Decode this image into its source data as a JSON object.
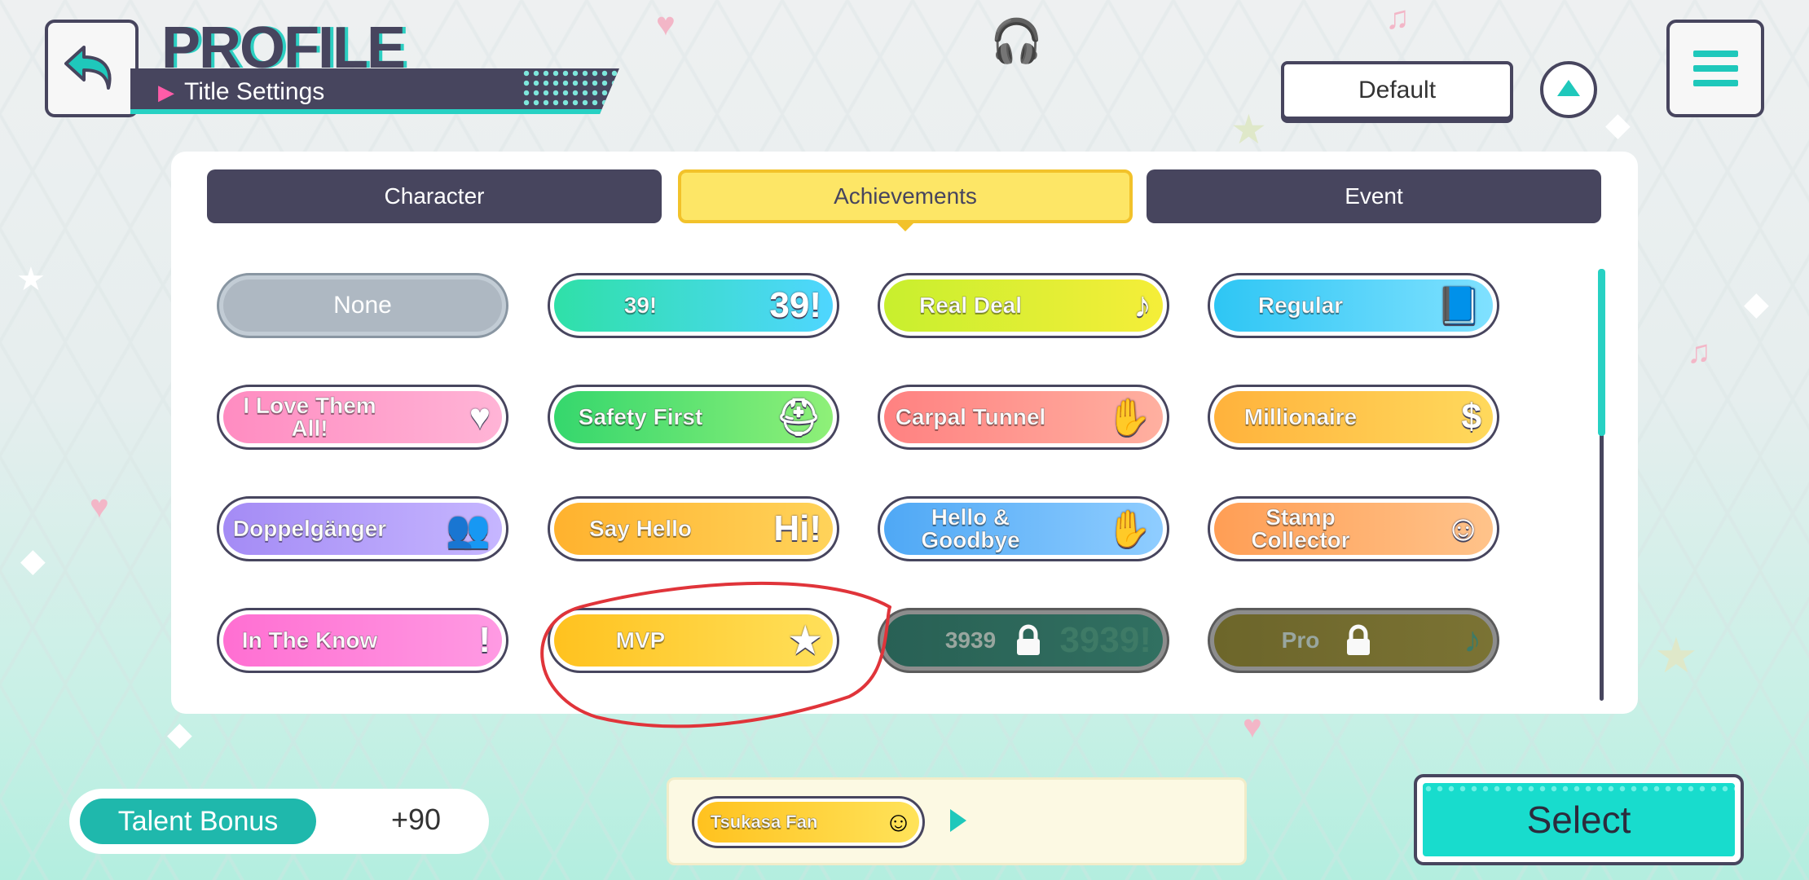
{
  "header": {
    "title": "PROFILE",
    "subtitle": "Title Settings",
    "default_label": "Default"
  },
  "tabs": [
    {
      "label": "Character",
      "active": false
    },
    {
      "label": "Achievements",
      "active": true
    },
    {
      "label": "Event",
      "active": false
    }
  ],
  "titles": [
    {
      "label": "None",
      "style": "none"
    },
    {
      "label": "39!",
      "art": "39!",
      "colors": [
        "#2fe0a8",
        "#4fd6ff"
      ]
    },
    {
      "label": "Real Deal",
      "art": "♪",
      "colors": [
        "#c8ef2e",
        "#f5ee39"
      ]
    },
    {
      "label": "Regular",
      "art": "📘",
      "colors": [
        "#2ec6f4",
        "#80e1ff"
      ]
    },
    {
      "label": "I Love Them All!",
      "art": "♥",
      "colors": [
        "#ff8cc1",
        "#ffb4d6"
      ]
    },
    {
      "label": "Safety First",
      "art": "⛑",
      "colors": [
        "#35d76d",
        "#8ff078"
      ]
    },
    {
      "label": "Carpal Tunnel",
      "art": "✋",
      "colors": [
        "#ff8181",
        "#ffb0a0"
      ]
    },
    {
      "label": "Millionaire",
      "art": "$",
      "colors": [
        "#ffb23c",
        "#ffd95c"
      ]
    },
    {
      "label": "Doppelgänger",
      "art": "👥",
      "colors": [
        "#a48bf5",
        "#c6b6ff"
      ]
    },
    {
      "label": "Say Hello",
      "art": "Hi!",
      "colors": [
        "#ffb22e",
        "#ffd35a"
      ]
    },
    {
      "label": "Hello & Goodbye",
      "art": "✋",
      "colors": [
        "#4fa8f5",
        "#8fcdff"
      ]
    },
    {
      "label": "Stamp Collector",
      "art": "☺",
      "colors": [
        "#ff9e55",
        "#ffc38a"
      ]
    },
    {
      "label": "In The Know",
      "art": "!",
      "colors": [
        "#ff6fd2",
        "#ff9ae3"
      ]
    },
    {
      "label": "MVP",
      "art": "★",
      "colors": [
        "#ffc21f",
        "#ffe05a"
      ]
    },
    {
      "label": "3939",
      "art": "3939!",
      "colors": [
        "#235e52",
        "#2d6f5f"
      ],
      "locked": true
    },
    {
      "label": "Pro",
      "art": "♪",
      "colors": [
        "#6b6425",
        "#7a7230"
      ],
      "locked": true
    }
  ],
  "footer": {
    "talent_label": "Talent Bonus",
    "talent_value": "+90",
    "current_title": "Tsukasa Fan",
    "select_label": "Select"
  }
}
